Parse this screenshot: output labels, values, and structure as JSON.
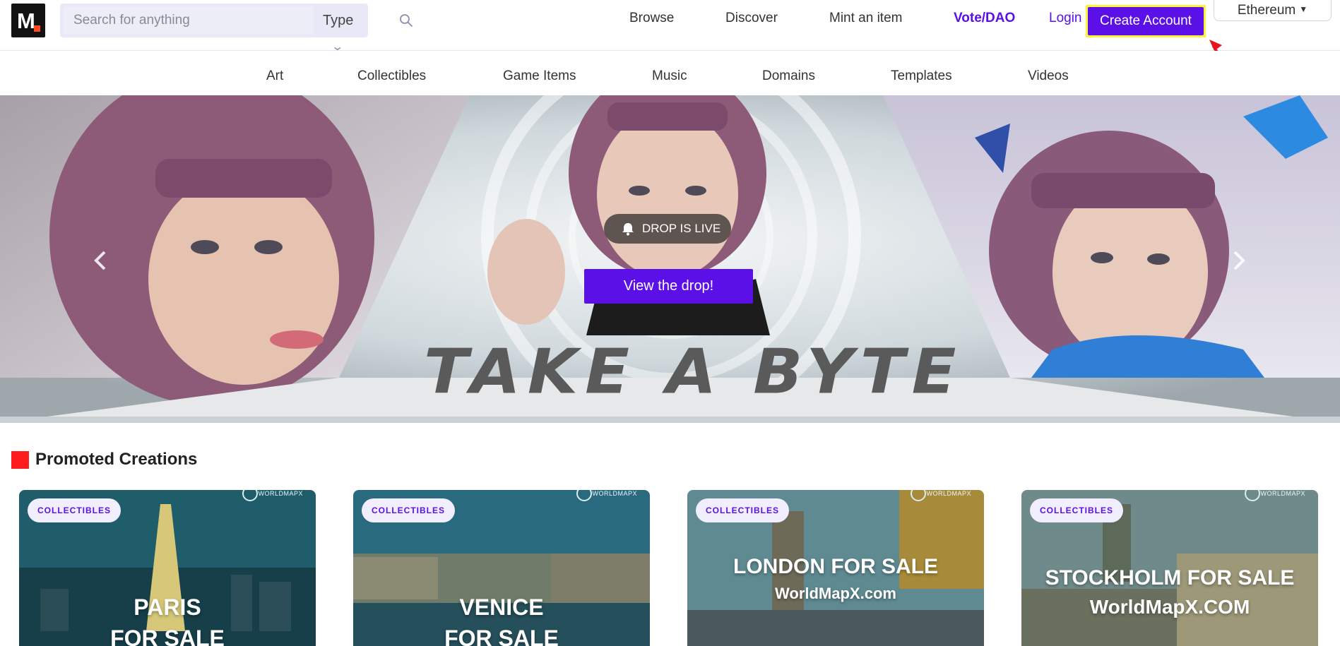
{
  "header": {
    "logo_letter": "M",
    "search_placeholder": "Search for anything",
    "type_label": "Type",
    "nav": {
      "browse": "Browse",
      "discover": "Discover",
      "mint": "Mint an item",
      "vote": "Vote/DAO",
      "login": "Login",
      "create_account": "Create Account"
    },
    "chain": "Ethereum"
  },
  "categories": [
    "Art",
    "Collectibles",
    "Game Items",
    "Music",
    "Domains",
    "Templates",
    "Videos"
  ],
  "hero": {
    "badge": "DROP IS LIVE",
    "cta": "View the drop!",
    "title": "TAKE A BYTE"
  },
  "promoted": {
    "title": "Promoted Creations",
    "cards": [
      {
        "badge": "COLLECTIBLES",
        "watermark": "WORLDMAPX",
        "line1": "PARIS",
        "line2": "FOR SALE"
      },
      {
        "badge": "COLLECTIBLES",
        "watermark": "WORLDMAPX",
        "line1": "VENICE",
        "line2": "FOR SALE"
      },
      {
        "badge": "COLLECTIBLES",
        "watermark": "WORLDMAPX",
        "line1": "LONDON FOR SALE",
        "line2": "WorldMapX.com"
      },
      {
        "badge": "COLLECTIBLES",
        "watermark": "WORLDMAPX",
        "line1": "STOCKHOLM FOR SALE",
        "line2": "WorldMapX.COM"
      }
    ]
  },
  "colors": {
    "brand_purple": "#5b10e8",
    "highlight_yellow": "#fff33a",
    "section_red": "#ff1d1d",
    "logo_accent": "#ff4c1e"
  }
}
